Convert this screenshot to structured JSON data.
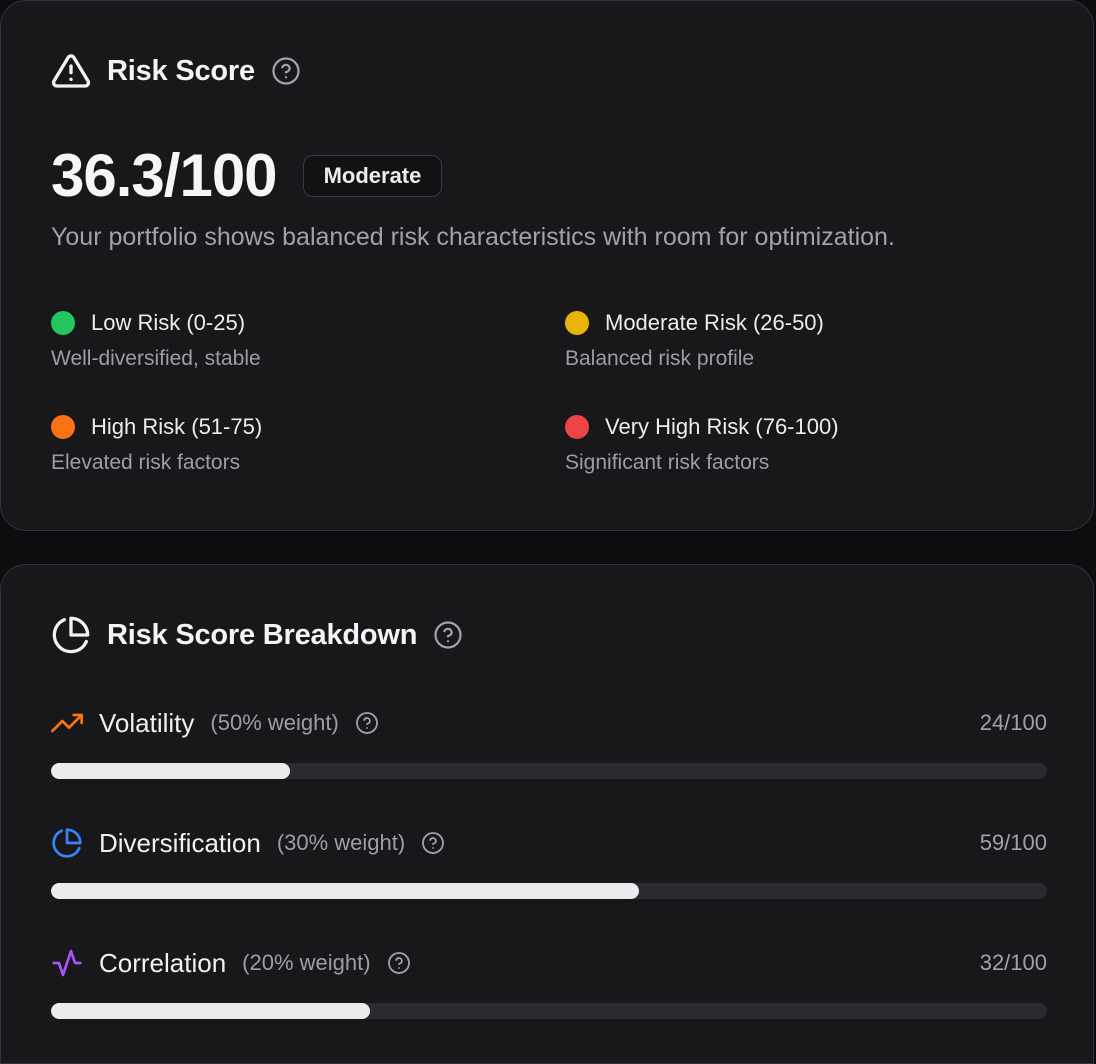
{
  "risk_score": {
    "title": "Risk Score",
    "title_icon": "alert-triangle-icon",
    "help_icon": "help-circle-icon",
    "score_text": "36.3/100",
    "badge": "Moderate",
    "description": "Your portfolio shows balanced risk characteristics with room for optimization.",
    "legend": [
      {
        "label": "Low Risk (0-25)",
        "sub": "Well-diversified, stable",
        "color": "#22c55e"
      },
      {
        "label": "Moderate Risk (26-50)",
        "sub": "Balanced risk profile",
        "color": "#eab308"
      },
      {
        "label": "High Risk (51-75)",
        "sub": "Elevated risk factors",
        "color": "#f97316"
      },
      {
        "label": "Very High Risk (76-100)",
        "sub": "Significant risk factors",
        "color": "#ef4444"
      }
    ]
  },
  "breakdown": {
    "title": "Risk Score Breakdown",
    "title_icon": "pie-chart-icon",
    "help_icon": "help-circle-icon",
    "metrics": [
      {
        "name": "Volatility",
        "weight": "(50% weight)",
        "value_text": "24/100",
        "value": 24,
        "icon": "trending-up-icon",
        "icon_color": "#f97316"
      },
      {
        "name": "Diversification",
        "weight": "(30% weight)",
        "value_text": "59/100",
        "value": 59,
        "icon": "pie-chart-icon",
        "icon_color": "#3b82f6"
      },
      {
        "name": "Correlation",
        "weight": "(20% weight)",
        "value_text": "32/100",
        "value": 32,
        "icon": "activity-icon",
        "icon_color": "#a855f7"
      }
    ]
  }
}
